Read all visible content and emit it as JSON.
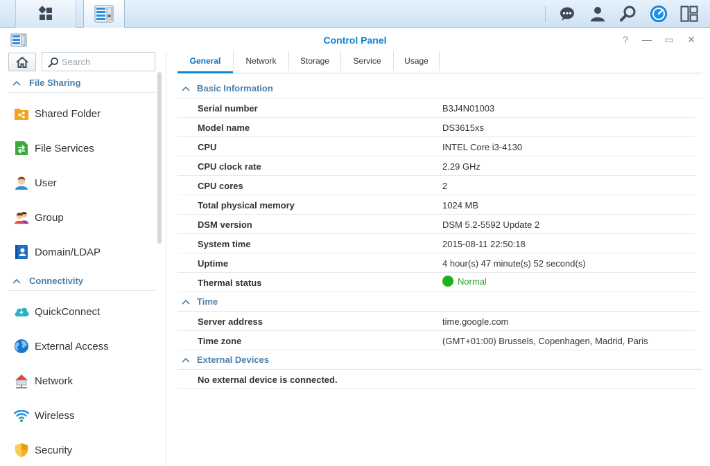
{
  "window": {
    "title": "Control Panel"
  },
  "window_controls": {
    "help": "?",
    "minimize": "—",
    "restore": "▭",
    "close": "✕"
  },
  "search": {
    "placeholder": "Search"
  },
  "sidebar": {
    "sections": [
      {
        "title": "File Sharing",
        "items": [
          "Shared Folder",
          "File Services",
          "User",
          "Group",
          "Domain/LDAP"
        ]
      },
      {
        "title": "Connectivity",
        "items": [
          "QuickConnect",
          "External Access",
          "Network",
          "Wireless",
          "Security"
        ]
      }
    ]
  },
  "tabs": [
    "General",
    "Network",
    "Storage",
    "Service",
    "Usage"
  ],
  "active_tab": "General",
  "groups": {
    "basic": {
      "title": "Basic Information",
      "rows": [
        {
          "label": "Serial number",
          "value": "B3J4N01003"
        },
        {
          "label": "Model name",
          "value": "DS3615xs"
        },
        {
          "label": "CPU",
          "value": "INTEL Core i3-4130"
        },
        {
          "label": "CPU clock rate",
          "value": "2.29 GHz"
        },
        {
          "label": "CPU cores",
          "value": "2"
        },
        {
          "label": "Total physical memory",
          "value": "1024 MB"
        },
        {
          "label": "DSM version",
          "value": "DSM 5.2-5592 Update 2"
        },
        {
          "label": "System time",
          "value": "2015-08-11 22:50:18"
        },
        {
          "label": "Uptime",
          "value": "4 hour(s) 47 minute(s) 52 second(s)"
        },
        {
          "label": "Thermal status",
          "value": "Normal"
        }
      ]
    },
    "time": {
      "title": "Time",
      "rows": [
        {
          "label": "Server address",
          "value": "time.google.com"
        },
        {
          "label": "Time zone",
          "value": "(GMT+01:00) Brussels, Copenhagen, Madrid, Paris"
        }
      ]
    },
    "external": {
      "title": "External Devices",
      "rows": [
        {
          "label": "No external device is connected.",
          "value": ""
        }
      ]
    }
  },
  "colors": {
    "accent": "#0b7fd3",
    "section_heading": "#4a7fab",
    "status_ok": "#1bb21b"
  }
}
